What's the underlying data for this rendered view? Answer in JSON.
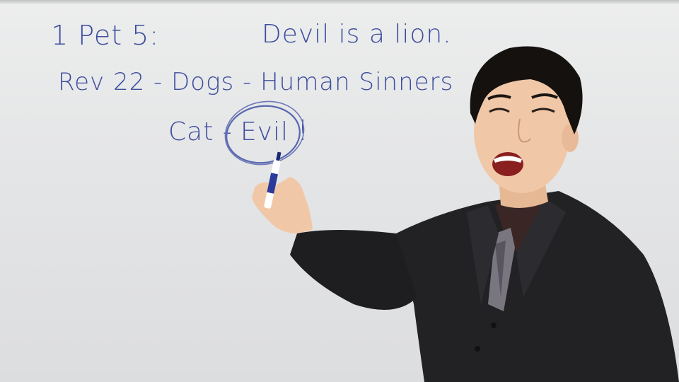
{
  "whiteboard": {
    "line1_left": "1 Pet 5:",
    "line1_right": "Devil is a lion.",
    "line2": "Rev 22 - Dogs - Human Sinners",
    "line3_cat": "Cat -",
    "line3_evil": "Evil",
    "line3_exclaim": "!"
  },
  "colors": {
    "marker_ink": "#3d4d9e",
    "suit": "#1f1f22",
    "shirt": "#3a2624",
    "skin": "#f0c8a8",
    "hair": "#14110f"
  }
}
